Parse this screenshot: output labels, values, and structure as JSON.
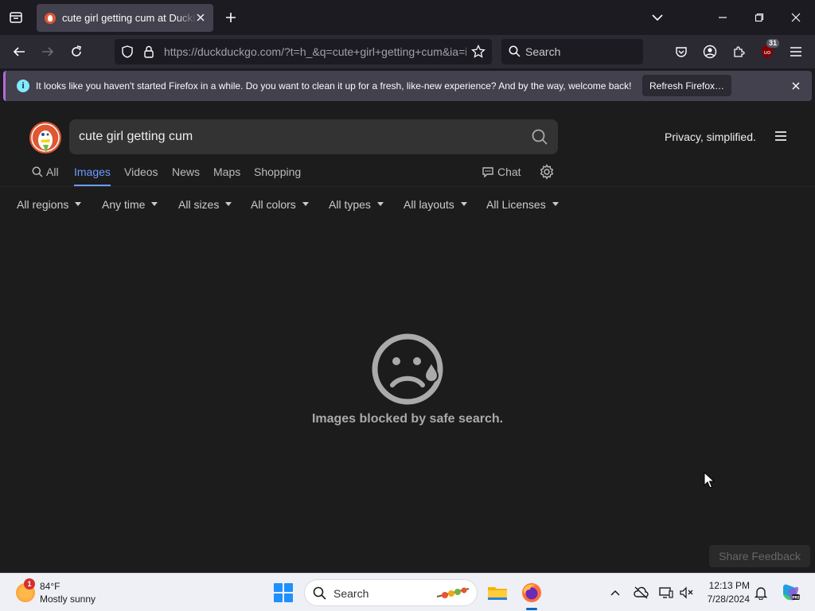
{
  "browser": {
    "tab_title": "cute girl getting cum at DuckDuckGo",
    "url_host": "https://duckduckgo.com",
    "url_rest": "/?t=h_&q=cute+girl+getting+cum&ia=images&iax=images",
    "search_placeholder": "Search",
    "ext_badge": "31"
  },
  "notification": {
    "text": "It looks like you haven't started Firefox in a while. Do you want to clean it up for a fresh, like-new experience? And by the way, welcome back!",
    "button": "Refresh Firefox…"
  },
  "ddg": {
    "query": "cute girl getting cum",
    "tagline": "Privacy, simplified.",
    "tabs": [
      "All",
      "Images",
      "Videos",
      "News",
      "Maps",
      "Shopping"
    ],
    "active_tab": "Images",
    "chat": "Chat",
    "filters": [
      "All regions",
      "Any time",
      "All sizes",
      "All colors",
      "All types",
      "All layouts",
      "All Licenses"
    ],
    "blocked_message": "Images blocked by safe search.",
    "share_feedback": "Share Feedback"
  },
  "taskbar": {
    "weather_temp": "84°F",
    "weather_desc": "Mostly sunny",
    "weather_badge": "1",
    "search_placeholder": "Search",
    "time": "12:13 PM",
    "date": "7/28/2024"
  },
  "colors": {
    "ddg_accent": "#6c9cff",
    "ddg_orange": "#de5833",
    "notification_border": "#b36ad8"
  }
}
